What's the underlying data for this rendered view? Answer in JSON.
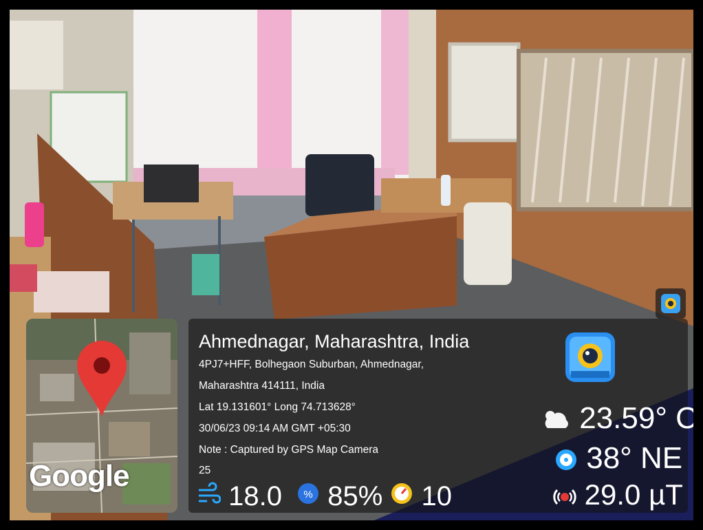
{
  "location": {
    "title": "Ahmednagar, Maharashtra, India",
    "address_line1": "4PJ7+HFF, Bolhegaon Suburban, Ahmednagar,",
    "address_line2": "Maharashtra 414111, India",
    "coordinates": "Lat 19.131601° Long 74.713628°",
    "datetime": "30/06/23 09:14 AM GMT +05:30",
    "note": "Note : Captured by GPS Map Camera",
    "extra": "25"
  },
  "map": {
    "label": "Google"
  },
  "weather": {
    "temperature": "23.59° C",
    "wind_direction": "38° NE",
    "magnetic_field": "29.0 µT",
    "wind_speed": "18.0",
    "humidity": "85%",
    "pressure": "10"
  },
  "icons": {
    "app": "gps-map-camera-icon",
    "weather": "cloud-sun-icon",
    "compass": "compass-icon",
    "magnet": "magnetic-field-icon",
    "wind": "wind-icon",
    "humidity": "humidity-icon",
    "pressure": "gauge-icon",
    "pin": "map-pin-icon"
  },
  "colors": {
    "pin": "#e53935",
    "accent": "#2aa8ff"
  }
}
